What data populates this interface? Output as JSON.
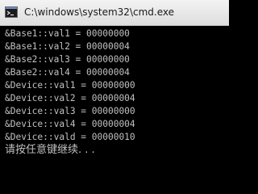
{
  "window": {
    "title": "C:\\windows\\system32\\cmd.exe",
    "icon": "cmd-icon"
  },
  "console": {
    "lines": [
      "&Base1::val1 = 00000000",
      "&Base1::val2 = 00000004",
      "&Base2::val3 = 00000000",
      "&Base2::val4 = 00000004",
      "&Device::val1 = 00000000",
      "&Device::val2 = 00000004",
      "&Device::val3 = 00000000",
      "&Device::val4 = 00000004",
      "&Device::vald = 00000010"
    ],
    "prompt": "请按任意键继续. . ."
  },
  "colors": {
    "console_background": "#000000",
    "console_text": "#c0c0c0",
    "titlebar": "#e9e9e9"
  }
}
